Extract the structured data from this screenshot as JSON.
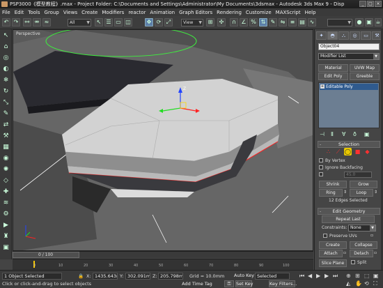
{
  "window": {
    "title": "PSP3000《模型教程》.max   - Project Folder: C:\\Documents and Settings\\Administrator\\My Documents\\3dsmax   - Autodesk 3ds Max 9   - Disp",
    "buttons": [
      "_",
      "□",
      "×"
    ]
  },
  "menubar": {
    "items": [
      "File",
      "Edit",
      "Tools",
      "Group",
      "Views",
      "Create",
      "Modifiers",
      "reactor",
      "Animation",
      "Graph Editors",
      "Rendering",
      "Customize",
      "MAXScript",
      "Help"
    ]
  },
  "toolbar": {
    "selection_filter": "All",
    "reference_coord": "View",
    "named_selection": ""
  },
  "viewport": {
    "label": "Perspective"
  },
  "timeline": {
    "time_slider": "0 / 100",
    "ticks": [
      "0",
      "10",
      "20",
      "30",
      "40",
      "50",
      "60",
      "70",
      "80",
      "90",
      "100"
    ]
  },
  "status": {
    "objects_selected": "1 Object Selected",
    "prompt": "Click or click-and-drag to select objects",
    "x_label": "X:",
    "x_value": "1435.643n",
    "y_label": "Y:",
    "y_value": "302.091m",
    "z_label": "Z:",
    "z_value": "205.798m",
    "grid": "Grid = 10.0mm",
    "add_time_tag": "Add Time Tag",
    "auto_key": "Auto Key",
    "set_key": "Set Key",
    "key_mode_value": "Selected",
    "key_filters": "Key Filters..."
  },
  "command_panel": {
    "object_name": "Object04",
    "modifier_list": "Modifier List",
    "buttons": {
      "material": "Material",
      "uvw_map": "UVW Map",
      "edit_poly": "Edit Poly",
      "greeble": "Greeble"
    },
    "stack": [
      "Editable Poly"
    ],
    "selection": {
      "title": "Selection",
      "by_vertex": "By Vertex",
      "ignore_backfacing": "Ignore Backfacing",
      "by_angle_value": "45.0",
      "shrink": "Shrink",
      "grow": "Grow",
      "ring": "Ring",
      "loop": "Loop",
      "status": "12 Edges Selected"
    },
    "edit_geometry": {
      "title": "Edit Geometry",
      "repeat_last": "Repeat Last",
      "constraints_label": "Constraints:",
      "constraints_value": "None",
      "preserve_uvs": "Preserve UVs",
      "create": "Create",
      "collapse": "Collapse",
      "attach": "Attach",
      "detach": "Detach",
      "slice_plane": "Slice Plane",
      "split": "Split"
    }
  },
  "colors": {
    "ui_background": "#444444",
    "viewport_background": "#5a5a5a",
    "selected_edge": "#ff2020",
    "active_subobject": "#e8c800",
    "stack_highlight": "#2f5a8e"
  }
}
